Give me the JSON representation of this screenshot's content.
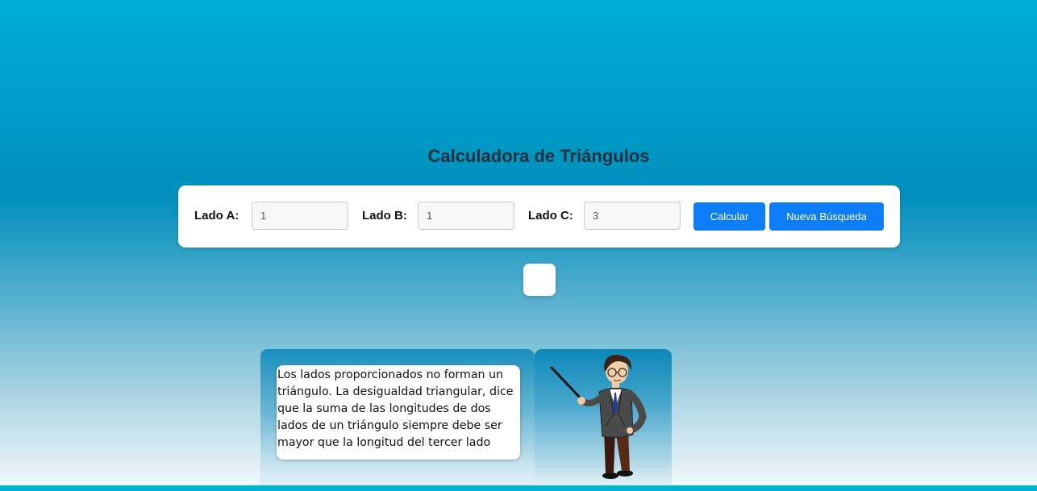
{
  "title": "Calculadora de Triángulos",
  "form": {
    "side_a_label": "Lado A:",
    "side_a_value": "1",
    "side_b_label": "Lado B:",
    "side_b_value": "1",
    "side_c_label": "Lado C:",
    "side_c_value": "3",
    "calculate_label": "Calcular",
    "new_search_label": "Nueva Búsqueda"
  },
  "result": {
    "message": "Los lados proporcionados no forman un triángulo. La desigualdad triangular, dice que la suma de las longitudes de dos lados de un triángulo siempre debe ser mayor que la longitud del tercer lado"
  },
  "colors": {
    "button": "#0d7ef8",
    "title": "#1f2f3d",
    "accent_bar": "#00b4d2"
  },
  "icons": {
    "teacher": "teacher-with-pointer-illustration"
  }
}
